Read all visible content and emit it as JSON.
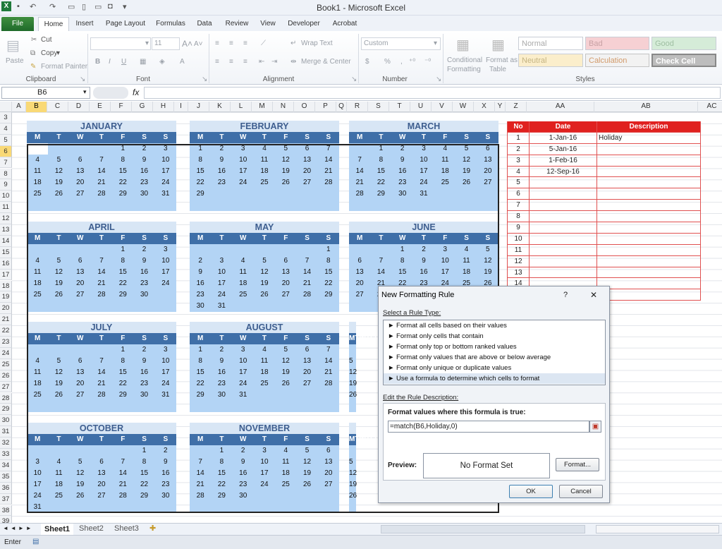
{
  "window": {
    "title": "Book1 - Microsoft Excel"
  },
  "tabs": [
    "File",
    "Home",
    "Insert",
    "Page Layout",
    "Formulas",
    "Data",
    "Review",
    "View",
    "Developer",
    "Acrobat"
  ],
  "ribbon": {
    "clipboard": {
      "paste": "Paste",
      "cut": "Cut",
      "copy": "Copy",
      "format_painter": "Format Painter",
      "label": "Clipboard"
    },
    "font": {
      "size": "11",
      "label": "Font"
    },
    "alignment": {
      "wrap": "Wrap Text",
      "merge": "Merge & Center",
      "label": "Alignment"
    },
    "number": {
      "format": "Custom",
      "label": "Number"
    },
    "cond": {
      "l1": "Conditional",
      "l2": "Formatting"
    },
    "fmt_table": {
      "l1": "Format as",
      "l2": "Table"
    },
    "styles": {
      "normal": "Normal",
      "bad": "Bad",
      "good": "Good",
      "neutral": "Neutral",
      "calculation": "Calculation",
      "check_cell": "Check Cell",
      "label": "Styles"
    }
  },
  "formula_bar": {
    "name_box": "B6",
    "fx": "fx"
  },
  "columns": [
    "A",
    "B",
    "C",
    "D",
    "E",
    "F",
    "G",
    "H",
    "I",
    "J",
    "K",
    "L",
    "M",
    "N",
    "O",
    "P",
    "Q",
    "R",
    "S",
    "T",
    "U",
    "V",
    "W",
    "X",
    "Y",
    "Z",
    "AA",
    "AB",
    "AC"
  ],
  "rows": [
    "3",
    "4",
    "5",
    "6",
    "7",
    "8",
    "9",
    "10",
    "11",
    "12",
    "13",
    "14",
    "15",
    "16",
    "17",
    "18",
    "19",
    "20",
    "21",
    "22",
    "23",
    "24",
    "25",
    "26",
    "27",
    "28",
    "29",
    "30",
    "31",
    "32",
    "33",
    "34",
    "35",
    "36",
    "37",
    "38",
    "39"
  ],
  "day_headers": [
    "M",
    "T",
    "W",
    "T",
    "F",
    "S",
    "S"
  ],
  "months": [
    {
      "name": "JANUARY",
      "weeks": [
        [
          "",
          "",
          "",
          "",
          "1",
          "2",
          "3"
        ],
        [
          "4",
          "5",
          "6",
          "7",
          "8",
          "9",
          "10"
        ],
        [
          "11",
          "12",
          "13",
          "14",
          "15",
          "16",
          "17"
        ],
        [
          "18",
          "19",
          "20",
          "21",
          "22",
          "23",
          "24"
        ],
        [
          "25",
          "26",
          "27",
          "28",
          "29",
          "30",
          "31"
        ],
        [
          "",
          "",
          "",
          "",
          "",
          "",
          ""
        ]
      ]
    },
    {
      "name": "FEBRUARY",
      "weeks": [
        [
          "1",
          "2",
          "3",
          "4",
          "5",
          "6",
          "7"
        ],
        [
          "8",
          "9",
          "10",
          "11",
          "12",
          "13",
          "14"
        ],
        [
          "15",
          "16",
          "17",
          "18",
          "19",
          "20",
          "21"
        ],
        [
          "22",
          "23",
          "24",
          "25",
          "26",
          "27",
          "28"
        ],
        [
          "29",
          "",
          "",
          "",
          "",
          "",
          ""
        ],
        [
          "",
          "",
          "",
          "",
          "",
          "",
          ""
        ]
      ]
    },
    {
      "name": "MARCH",
      "weeks": [
        [
          "",
          "1",
          "2",
          "3",
          "4",
          "5",
          "6"
        ],
        [
          "7",
          "8",
          "9",
          "10",
          "11",
          "12",
          "13"
        ],
        [
          "14",
          "15",
          "16",
          "17",
          "18",
          "19",
          "20"
        ],
        [
          "21",
          "22",
          "23",
          "24",
          "25",
          "26",
          "27"
        ],
        [
          "28",
          "29",
          "30",
          "31",
          "",
          "",
          ""
        ],
        [
          "",
          "",
          "",
          "",
          "",
          "",
          ""
        ]
      ]
    },
    {
      "name": "APRIL",
      "weeks": [
        [
          "",
          "",
          "",
          "",
          "1",
          "2",
          "3"
        ],
        [
          "4",
          "5",
          "6",
          "7",
          "8",
          "9",
          "10"
        ],
        [
          "11",
          "12",
          "13",
          "14",
          "15",
          "16",
          "17"
        ],
        [
          "18",
          "19",
          "20",
          "21",
          "22",
          "23",
          "24"
        ],
        [
          "25",
          "26",
          "27",
          "28",
          "29",
          "30",
          ""
        ],
        [
          "",
          "",
          "",
          "",
          "",
          "",
          ""
        ]
      ]
    },
    {
      "name": "MAY",
      "weeks": [
        [
          "",
          "",
          "",
          "",
          "",
          "",
          "1"
        ],
        [
          "2",
          "3",
          "4",
          "5",
          "6",
          "7",
          "8"
        ],
        [
          "9",
          "10",
          "11",
          "12",
          "13",
          "14",
          "15"
        ],
        [
          "16",
          "17",
          "18",
          "19",
          "20",
          "21",
          "22"
        ],
        [
          "23",
          "24",
          "25",
          "26",
          "27",
          "28",
          "29"
        ],
        [
          "30",
          "31",
          "",
          "",
          "",
          "",
          ""
        ]
      ]
    },
    {
      "name": "JUNE",
      "weeks": [
        [
          "",
          "",
          "1",
          "2",
          "3",
          "4",
          "5"
        ],
        [
          "6",
          "7",
          "8",
          "9",
          "10",
          "11",
          "12"
        ],
        [
          "13",
          "14",
          "15",
          "16",
          "17",
          "18",
          "19"
        ],
        [
          "20",
          "21",
          "22",
          "23",
          "24",
          "25",
          "26"
        ],
        [
          "27",
          "28",
          "29",
          "30",
          "",
          "",
          ""
        ],
        [
          "",
          "",
          "",
          "",
          "",
          "",
          ""
        ]
      ]
    },
    {
      "name": "JULY",
      "weeks": [
        [
          "",
          "",
          "",
          "",
          "1",
          "2",
          "3"
        ],
        [
          "4",
          "5",
          "6",
          "7",
          "8",
          "9",
          "10"
        ],
        [
          "11",
          "12",
          "13",
          "14",
          "15",
          "16",
          "17"
        ],
        [
          "18",
          "19",
          "20",
          "21",
          "22",
          "23",
          "24"
        ],
        [
          "25",
          "26",
          "27",
          "28",
          "29",
          "30",
          "31"
        ],
        [
          "",
          "",
          "",
          "",
          "",
          "",
          ""
        ]
      ]
    },
    {
      "name": "AUGUST",
      "weeks": [
        [
          "1",
          "2",
          "3",
          "4",
          "5",
          "6",
          "7"
        ],
        [
          "8",
          "9",
          "10",
          "11",
          "12",
          "13",
          "14"
        ],
        [
          "15",
          "16",
          "17",
          "18",
          "19",
          "20",
          "21"
        ],
        [
          "22",
          "23",
          "24",
          "25",
          "26",
          "27",
          "28"
        ],
        [
          "29",
          "30",
          "31",
          "",
          "",
          "",
          ""
        ],
        [
          "",
          "",
          "",
          "",
          "",
          "",
          ""
        ]
      ]
    },
    {
      "name": "",
      "weeks": [
        [
          "",
          "",
          "",
          "",
          "",
          "",
          ""
        ],
        [
          "5",
          "",
          "",
          "",
          "",
          "",
          ""
        ],
        [
          "12",
          "",
          "",
          "",
          "",
          "",
          ""
        ],
        [
          "19",
          "",
          "",
          "",
          "",
          "",
          ""
        ],
        [
          "26",
          "",
          "",
          "",
          "",
          "",
          ""
        ],
        [
          "",
          "",
          "",
          "",
          "",
          "",
          ""
        ]
      ]
    },
    {
      "name": "OCTOBER",
      "weeks": [
        [
          "",
          "",
          "",
          "",
          "",
          "1",
          "2"
        ],
        [
          "3",
          "4",
          "5",
          "6",
          "7",
          "8",
          "9"
        ],
        [
          "10",
          "11",
          "12",
          "13",
          "14",
          "15",
          "16"
        ],
        [
          "17",
          "18",
          "19",
          "20",
          "21",
          "22",
          "23"
        ],
        [
          "24",
          "25",
          "26",
          "27",
          "28",
          "29",
          "30"
        ],
        [
          "31",
          "",
          "",
          "",
          "",
          "",
          ""
        ]
      ]
    },
    {
      "name": "NOVEMBER",
      "weeks": [
        [
          "",
          "1",
          "2",
          "3",
          "4",
          "5",
          "6"
        ],
        [
          "7",
          "8",
          "9",
          "10",
          "11",
          "12",
          "13"
        ],
        [
          "14",
          "15",
          "16",
          "17",
          "18",
          "19",
          "20"
        ],
        [
          "21",
          "22",
          "23",
          "24",
          "25",
          "26",
          "27"
        ],
        [
          "28",
          "29",
          "30",
          "",
          "",
          "",
          ""
        ],
        [
          "",
          "",
          "",
          "",
          "",
          "",
          ""
        ]
      ]
    },
    {
      "name": "",
      "weeks": [
        [
          "",
          "",
          "",
          "",
          "",
          "",
          ""
        ],
        [
          "5",
          "",
          "",
          "",
          "",
          "",
          ""
        ],
        [
          "12",
          "",
          "",
          "",
          "",
          "",
          ""
        ],
        [
          "19",
          "",
          "",
          "",
          "",
          "",
          ""
        ],
        [
          "26",
          "",
          "",
          "",
          "",
          "",
          ""
        ],
        [
          "",
          "",
          "",
          "",
          "",
          "",
          ""
        ]
      ]
    }
  ],
  "holidays": {
    "headers": [
      "No",
      "Date",
      "Description"
    ],
    "rows": [
      [
        "1",
        "1-Jan-16",
        "Holiday"
      ],
      [
        "2",
        "5-Jan-16",
        ""
      ],
      [
        "3",
        "1-Feb-16",
        ""
      ],
      [
        "4",
        "12-Sep-16",
        ""
      ],
      [
        "5",
        "",
        ""
      ],
      [
        "6",
        "",
        ""
      ],
      [
        "7",
        "",
        ""
      ],
      [
        "8",
        "",
        ""
      ],
      [
        "9",
        "",
        ""
      ],
      [
        "10",
        "",
        ""
      ],
      [
        "11",
        "",
        ""
      ],
      [
        "12",
        "",
        ""
      ],
      [
        "13",
        "",
        ""
      ],
      [
        "14",
        "",
        ""
      ],
      [
        "15",
        "",
        ""
      ]
    ]
  },
  "dialog": {
    "title": "New Formatting Rule",
    "help": "?",
    "close": "✕",
    "select_label": "Select a Rule Type:",
    "rule_types": [
      "► Format all cells based on their values",
      "► Format only cells that contain",
      "► Format only top or bottom ranked values",
      "► Format only values that are above or below average",
      "► Format only unique or duplicate values",
      "► Use a formula to determine which cells to format"
    ],
    "edit_label": "Edit the Rule Description:",
    "formula_label": "Format values where this formula is true:",
    "formula": "=match(B6,Holiday,0)",
    "preview_label": "Preview:",
    "preview_text": "No Format Set",
    "format_button": "Format...",
    "ok": "OK",
    "cancel": "Cancel"
  },
  "sheets": [
    "Sheet1",
    "Sheet2",
    "Sheet3"
  ],
  "status": {
    "mode": "Enter"
  },
  "colors": {
    "accent": "#3f6fa8",
    "month_bg": "#b3d4f5",
    "holiday_red": "#e0211f"
  }
}
